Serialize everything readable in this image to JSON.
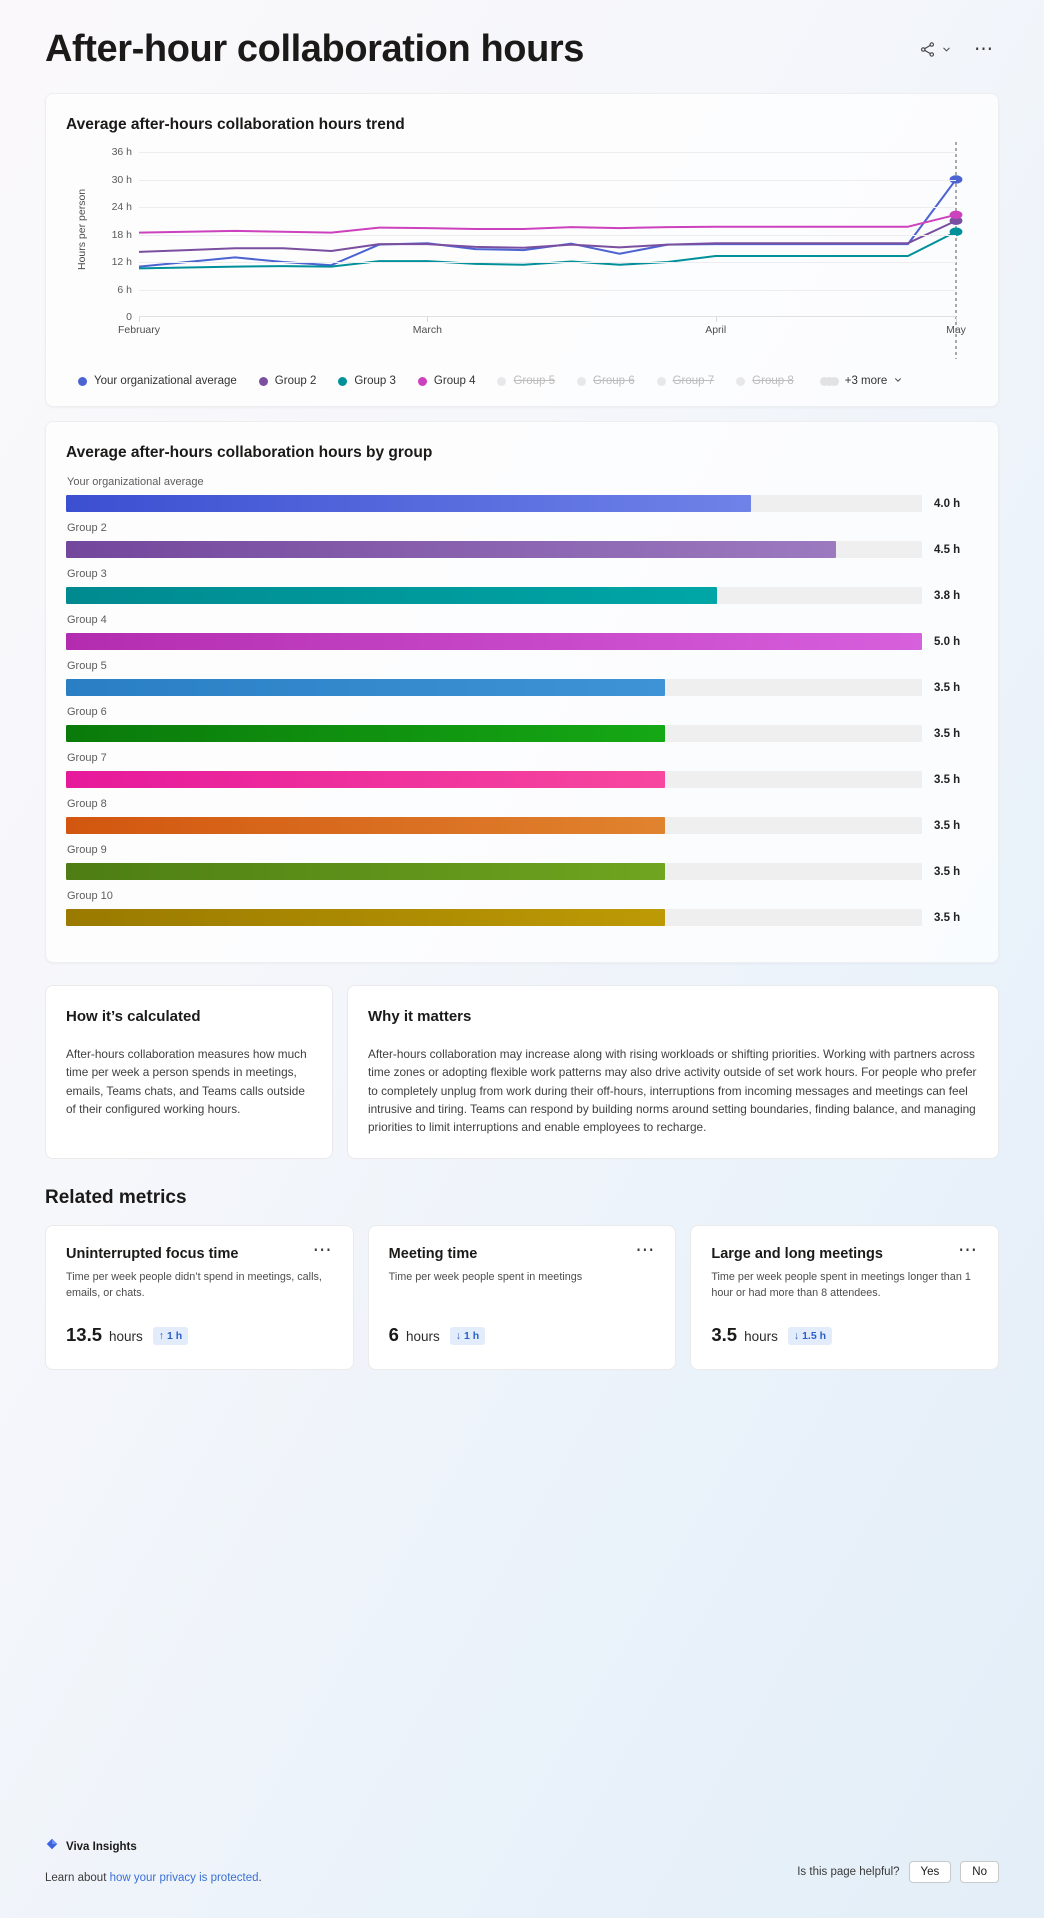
{
  "header": {
    "title": "After-hour collaboration hours",
    "share_icon": "share-icon",
    "chevron_icon": "chevron-down-icon",
    "more_icon": "more-options-icon"
  },
  "trend_card": {
    "title": "Average after-hours collaboration hours trend"
  },
  "group_card": {
    "title": "Average after-hours collaboration hours by group"
  },
  "legend": {
    "items": [
      {
        "label": "Your organizational average",
        "color": "#4c63d2",
        "active": true
      },
      {
        "label": "Group 2",
        "color": "#7b4fa0",
        "active": true
      },
      {
        "label": "Group 3",
        "color": "#00909a",
        "active": true
      },
      {
        "label": "Group 4",
        "color": "#cc41bd",
        "active": true
      },
      {
        "label": "Group 5",
        "color": "#e8e8ea",
        "active": false
      },
      {
        "label": "Group 6",
        "color": "#e8e8ea",
        "active": false
      },
      {
        "label": "Group 7",
        "color": "#e8e8ea",
        "active": false
      },
      {
        "label": "Group 8",
        "color": "#e8e8ea",
        "active": false
      }
    ],
    "more_label": "+3 more"
  },
  "chart_data": [
    {
      "type": "line",
      "title": "Average after-hours collaboration hours trend",
      "xlabel": "",
      "ylabel": "Hours per person",
      "ylim": [
        0,
        36
      ],
      "yticks": [
        "0",
        "6 h",
        "12 h",
        "18 h",
        "24 h",
        "30 h",
        "36 h"
      ],
      "ytick_values": [
        0,
        6,
        12,
        18,
        24,
        30,
        36
      ],
      "xticks": [
        "February",
        "March",
        "April",
        "May"
      ],
      "xtick_positions": [
        0,
        6,
        12,
        17
      ],
      "grid": true,
      "legend_position": "bottom",
      "x": [
        0,
        1,
        2,
        3,
        4,
        5,
        6,
        7,
        8,
        9,
        10,
        11,
        12,
        13,
        14,
        15,
        16,
        17
      ],
      "series": [
        {
          "name": "Your organizational average",
          "color": "#4c63d2",
          "values": [
            11.0,
            12.0,
            13.0,
            12.0,
            11.3,
            15.8,
            16.1,
            14.8,
            14.6,
            16.0,
            13.8,
            15.8,
            15.9,
            15.9,
            15.9,
            15.9,
            15.9,
            30.0
          ],
          "end_marker": true
        },
        {
          "name": "Group 2",
          "color": "#7b4fa0",
          "values": [
            14.2,
            14.6,
            15.0,
            15.0,
            14.4,
            15.9,
            15.9,
            15.3,
            15.1,
            15.8,
            15.2,
            15.8,
            16.1,
            16.1,
            16.1,
            16.1,
            16.1,
            21.0
          ],
          "end_marker": true
        },
        {
          "name": "Group 3",
          "color": "#00909a",
          "values": [
            10.6,
            10.8,
            11.0,
            11.1,
            11.0,
            12.2,
            12.2,
            11.6,
            11.4,
            12.1,
            11.4,
            12.0,
            13.3,
            13.3,
            13.3,
            13.3,
            13.3,
            18.6
          ],
          "end_marker": true
        },
        {
          "name": "Group 4",
          "color": "#cc41bd",
          "values": [
            18.4,
            18.6,
            18.8,
            18.6,
            18.4,
            19.5,
            19.4,
            19.2,
            19.2,
            19.6,
            19.4,
            19.6,
            19.7,
            19.7,
            19.7,
            19.7,
            19.7,
            22.3
          ],
          "end_marker": true
        }
      ],
      "annotations": [
        {
          "type": "vertical-dotted-line",
          "x": 17
        }
      ]
    },
    {
      "type": "bar",
      "orientation": "horizontal",
      "title": "Average after-hours collaboration hours by group",
      "xlabel": "",
      "ylabel": "",
      "max_value": 5.0,
      "categories": [
        "Your organizational average",
        "Group 2",
        "Group 3",
        "Group 4",
        "Group 5",
        "Group 6",
        "Group 7",
        "Group 8",
        "Group 9",
        "Group 10"
      ],
      "values": [
        4.0,
        4.5,
        3.8,
        5.0,
        3.5,
        3.5,
        3.5,
        3.5,
        3.5,
        3.5
      ],
      "value_labels": [
        "4.0 h",
        "4.5 h",
        "3.8 h",
        "5.0 h",
        "3.5 h",
        "3.5 h",
        "3.5 h",
        "3.5 h",
        "3.5 h",
        "3.5 h"
      ],
      "colors": [
        {
          "from": "#3b4fd1",
          "to": "#6f82e8"
        },
        {
          "from": "#73479c",
          "to": "#9c7ac0"
        },
        {
          "from": "#008a90",
          "to": "#00a6a6"
        },
        {
          "from": "#b32cb0",
          "to": "#d760dd"
        },
        {
          "from": "#2a7fc4",
          "to": "#3e93d6"
        },
        {
          "from": "#0a7a0a",
          "to": "#15a815"
        },
        {
          "from": "#e6199b",
          "to": "#f7479f"
        },
        {
          "from": "#d2560f",
          "to": "#e0832f"
        },
        {
          "from": "#4d7d14",
          "to": "#6fa51f"
        },
        {
          "from": "#9a7a00",
          "to": "#bd9a05"
        }
      ]
    }
  ],
  "info_cards": [
    {
      "title": "How it’s calculated",
      "body": "After-hours collaboration measures how much time per week a person spends in meetings, emails, Teams chats, and Teams calls outside of their configured working hours."
    },
    {
      "title": "Why it matters",
      "body": "After-hours collaboration may increase along with rising workloads or shifting priorities. Working with partners across time zones or adopting flexible work patterns may also drive activity outside of set work hours. For people who prefer to completely unplug from work during their off-hours, interruptions from incoming messages and meetings can feel intrusive and tiring. Teams can respond by building norms around setting boundaries, finding balance, and managing priorities to limit interruptions and enable employees to recharge."
    }
  ],
  "related": {
    "section_title": "Related metrics",
    "cards": [
      {
        "title": "Uninterrupted focus time",
        "description": "Time per week people didn’t spend in meetings, calls, emails, or chats.",
        "value": "13.5",
        "unit": "hours",
        "delta": "1 h",
        "delta_direction": "up",
        "more_icon": "more-options-icon"
      },
      {
        "title": "Meeting time",
        "description": "Time per week people spent in meetings",
        "value": "6",
        "unit": "hours",
        "delta": "1 h",
        "delta_direction": "down",
        "more_icon": "more-options-icon"
      },
      {
        "title": "Large and long meetings",
        "description": "Time per week people spent in meetings longer than 1 hour or had more than 8 attendees.",
        "value": "3.5",
        "unit": "hours",
        "delta": "1.5 h",
        "delta_direction": "down",
        "more_icon": "more-options-icon"
      }
    ]
  },
  "footer": {
    "brand": "Viva Insights",
    "brand_icon": "viva-insights-diamond-icon",
    "privacy_prefix": "Learn about ",
    "privacy_link": "how your privacy is protected",
    "privacy_suffix": ".",
    "helpful_label": "Is this page helpful?",
    "yes_label": "Yes",
    "no_label": "No"
  },
  "colors": {
    "accent": "#3b6fd4",
    "delta_bg": "#e3ecfb",
    "delta_text": "#2a5fc9"
  }
}
